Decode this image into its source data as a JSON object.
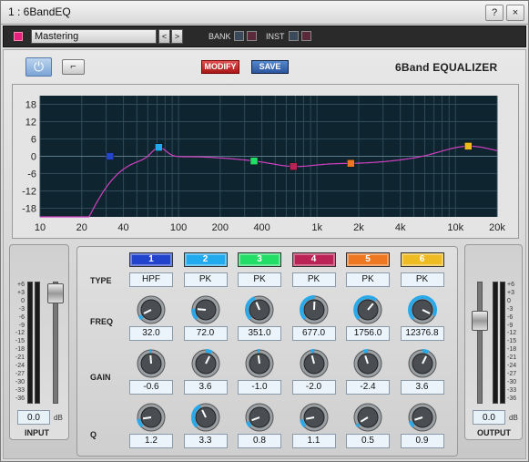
{
  "window": {
    "title": "1 : 6BandEQ",
    "buttons": {
      "help": "?",
      "close": "×"
    }
  },
  "toolbar": {
    "preset_name": "Mastering",
    "prev": "<",
    "next": ">",
    "bank_label": "BANK",
    "inst_label": "INST",
    "pin_color": "#e4217f"
  },
  "header": {
    "power_glyph": "⏻",
    "bypass_glyph": "⌐",
    "modify_label": "MODIFY",
    "save_label": "SAVE",
    "product_title": "6Band EQUALIZER"
  },
  "graph": {
    "y_ticks": [
      18,
      12,
      6,
      0,
      -6,
      -12,
      -18
    ],
    "x_ticks": [
      "10",
      "20",
      "40",
      "100",
      "200",
      "400",
      "1k",
      "2k",
      "4k",
      "10k",
      "20k"
    ],
    "y_range": [
      -21,
      21
    ],
    "x_range_hz": [
      10,
      20000
    ],
    "curve_color": "#d040c0",
    "background": "#0e2530"
  },
  "bands": [
    {
      "number": "1",
      "color": "#2244cc",
      "type": "HPF",
      "freq": "32.0",
      "gain": "-0.6",
      "q": "1.2"
    },
    {
      "number": "2",
      "color": "#22aaee",
      "type": "PK",
      "freq": "72.0",
      "gain": "3.6",
      "q": "3.3"
    },
    {
      "number": "3",
      "color": "#22dd66",
      "type": "PK",
      "freq": "351.0",
      "gain": "-1.0",
      "q": "0.8"
    },
    {
      "number": "4",
      "color": "#bb2255",
      "type": "PK",
      "freq": "677.0",
      "gain": "-2.0",
      "q": "1.1"
    },
    {
      "number": "5",
      "color": "#ee7722",
      "type": "PK",
      "freq": "1756.0",
      "gain": "-2.4",
      "q": "0.5"
    },
    {
      "number": "6",
      "color": "#eebb22",
      "type": "PK",
      "freq": "12376.8",
      "gain": "3.6",
      "q": "0.9"
    }
  ],
  "rows": {
    "type": "TYPE",
    "freq": "FREQ",
    "gain": "GAIN",
    "q": "Q"
  },
  "input": {
    "label": "INPUT",
    "value": "0.0",
    "unit": "dB",
    "level_db": 0.0
  },
  "output": {
    "label": "OUTPUT",
    "value": "0.0",
    "unit": "dB",
    "level_db": 0.0
  },
  "meter_scale": [
    "+6",
    "+3",
    "0",
    "-3",
    "-6",
    "-9",
    "-12",
    "-15",
    "-18",
    "-21",
    "-24",
    "-27",
    "-30",
    "-33",
    "-36"
  ]
}
